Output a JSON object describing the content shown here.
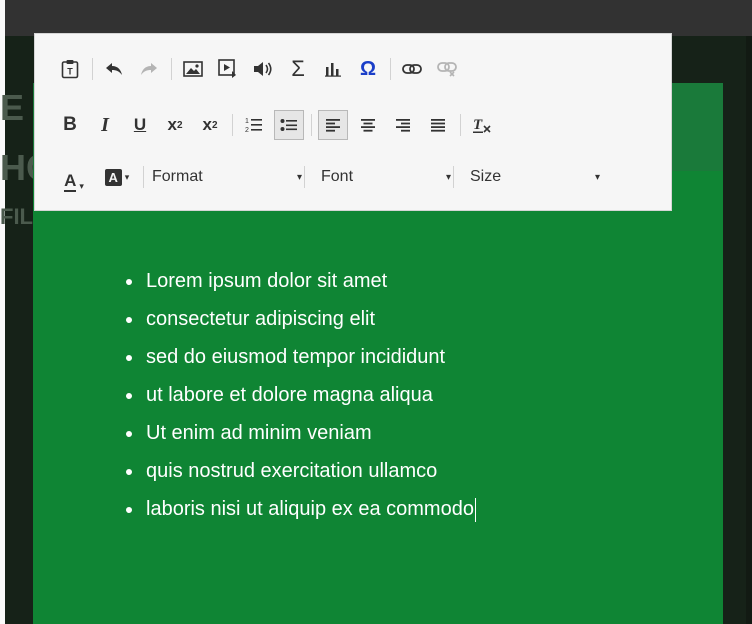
{
  "background": {
    "ghost_letters": [
      "E",
      "HC",
      "FIL"
    ]
  },
  "toolbar": {
    "row1": [
      {
        "icon": "paste-text-icon",
        "glyph": "📋"
      },
      {
        "icon": "undo-icon",
        "glyph": "↶"
      },
      {
        "icon": "redo-icon",
        "glyph": "↷"
      },
      {
        "icon": "image-icon",
        "glyph": "▣"
      },
      {
        "icon": "media-icon",
        "glyph": "▶"
      },
      {
        "icon": "audio-icon",
        "glyph": "🔊"
      },
      {
        "icon": "sum-icon",
        "glyph": "Σ"
      },
      {
        "icon": "chart-icon",
        "glyph": "ıll"
      },
      {
        "icon": "special-char-icon",
        "glyph": "Ω"
      },
      {
        "icon": "link-icon",
        "glyph": "⚭"
      },
      {
        "icon": "unlink-icon",
        "glyph": "⚭"
      }
    ],
    "row2": {
      "bold": "B",
      "italic": "I",
      "underline": "U",
      "subscript": "x",
      "subscript_small": "2",
      "superscript": "x",
      "superscript_small": "2",
      "numbered_list": "⒈",
      "bullet_list": "☰",
      "align_left": "≡",
      "align_center": "≡",
      "align_right": "≡",
      "justify": "≡",
      "clear_format": "T"
    },
    "row3": {
      "text_color_label": "A",
      "bg_color_label": "A",
      "format_label": "Format",
      "font_label": "Font",
      "size_label": "Size",
      "caret": "▾"
    }
  },
  "content": {
    "bullets": [
      "Lorem ipsum dolor sit amet",
      "consectetur adipiscing elit",
      "sed do eiusmod tempor incididunt",
      "ut labore et dolore magna aliqua",
      "Ut enim ad minim veniam",
      "quis nostrud exercitation ullamco",
      "laboris nisi ut aliquip ex ea commodo"
    ]
  },
  "colors": {
    "accent_green": "#0f8534",
    "header_green": "#1a7a3a",
    "special_char_blue": "#1a3ec8"
  }
}
